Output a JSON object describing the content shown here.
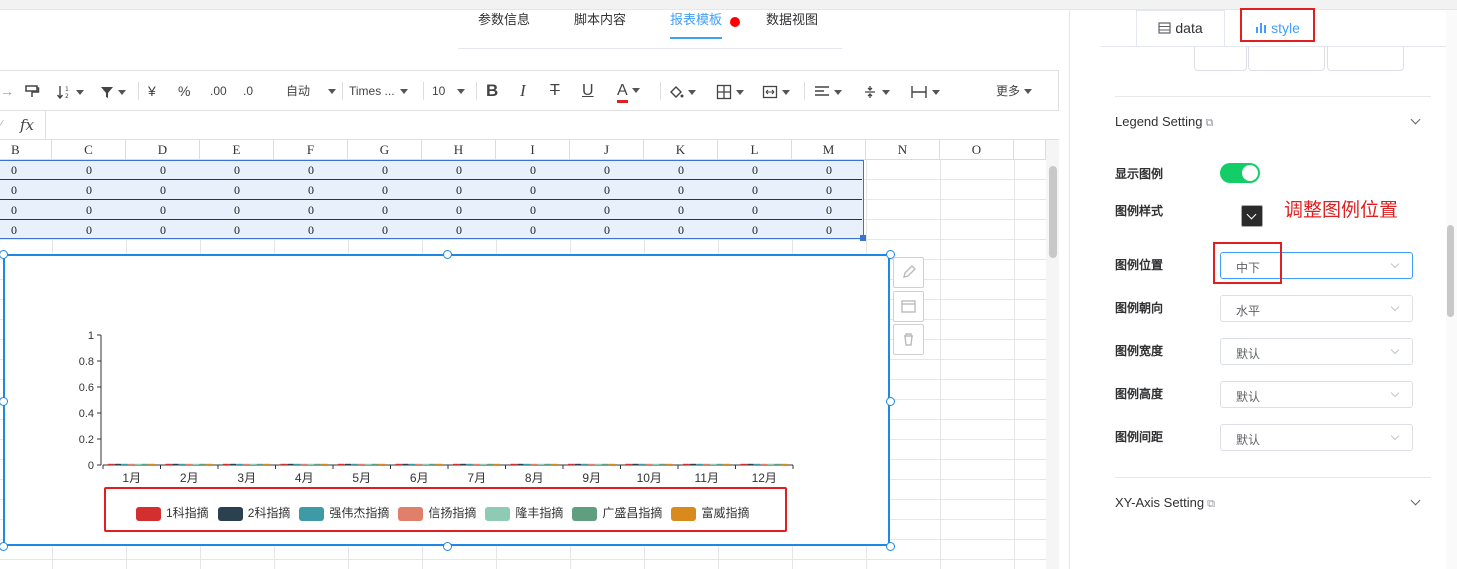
{
  "main_tabs": [
    {
      "label": "参数信息",
      "active": false
    },
    {
      "label": "脚本内容",
      "active": false
    },
    {
      "label": "报表模板",
      "active": true
    },
    {
      "label": "数据视图",
      "active": false
    }
  ],
  "toolbar": {
    "wrap_mode": "自动",
    "font_name": "Times ...",
    "font_size": "10",
    "bold": "B",
    "italic": "I",
    "strike": "T",
    "underline": "U",
    "font_color": "A",
    "more": "更多",
    "currency": "¥",
    "percent": "%",
    "decimal_inc": ".00",
    "decimal_dec": ".0",
    "font_color_hex": "#e02020"
  },
  "formula_bar": {
    "fx_label": "fx"
  },
  "columns": [
    "B",
    "C",
    "D",
    "E",
    "F",
    "G",
    "H",
    "I",
    "J",
    "K",
    "L",
    "M",
    "N",
    "O"
  ],
  "data_rows": [
    [
      "0",
      "0",
      "0",
      "0",
      "0",
      "0",
      "0",
      "0",
      "0",
      "0",
      "0",
      "0"
    ],
    [
      "0",
      "0",
      "0",
      "0",
      "0",
      "0",
      "0",
      "0",
      "0",
      "0",
      "0",
      "0"
    ],
    [
      "0",
      "0",
      "0",
      "0",
      "0",
      "0",
      "0",
      "0",
      "0",
      "0",
      "0",
      "0"
    ],
    [
      "0",
      "0",
      "0",
      "0",
      "0",
      "0",
      "0",
      "0",
      "0",
      "0",
      "0",
      "0"
    ]
  ],
  "chart_data": {
    "type": "bar",
    "categories": [
      "1月",
      "2月",
      "3月",
      "4月",
      "5月",
      "6月",
      "7月",
      "8月",
      "9月",
      "10月",
      "11月",
      "12月"
    ],
    "series": [
      {
        "name": "1科指摘",
        "color": "#d32f2f",
        "values": [
          0,
          0,
          0,
          0,
          0,
          0,
          0,
          0,
          0,
          0,
          0,
          0
        ]
      },
      {
        "name": "2科指摘",
        "color": "#2b4150",
        "values": [
          0,
          0,
          0,
          0,
          0,
          0,
          0,
          0,
          0,
          0,
          0,
          0
        ]
      },
      {
        "name": "强伟杰指摘",
        "color": "#3f9aa7",
        "values": [
          0,
          0,
          0,
          0,
          0,
          0,
          0,
          0,
          0,
          0,
          0,
          0
        ]
      },
      {
        "name": "信扬指摘",
        "color": "#e0806b",
        "values": [
          0,
          0,
          0,
          0,
          0,
          0,
          0,
          0,
          0,
          0,
          0,
          0
        ]
      },
      {
        "name": "隆丰指摘",
        "color": "#8dcbb4",
        "values": [
          0,
          0,
          0,
          0,
          0,
          0,
          0,
          0,
          0,
          0,
          0,
          0
        ]
      },
      {
        "name": "广盛昌指摘",
        "color": "#5f9e7e",
        "values": [
          0,
          0,
          0,
          0,
          0,
          0,
          0,
          0,
          0,
          0,
          0,
          0
        ]
      },
      {
        "name": "富威指摘",
        "color": "#d98a1c",
        "values": [
          0,
          0,
          0,
          0,
          0,
          0,
          0,
          0,
          0,
          0,
          0,
          0
        ]
      }
    ],
    "yticks": [
      "0",
      "0.2",
      "0.4",
      "0.6",
      "0.8",
      "1"
    ],
    "ylim": [
      0,
      1
    ],
    "legend": "bottom-center",
    "grid": false
  },
  "right_panel": {
    "tabs": [
      {
        "label": "data",
        "icon": "table-icon",
        "active": false
      },
      {
        "label": "style",
        "icon": "bar-chart-icon",
        "active": true
      }
    ],
    "legend_section_title": "Legend Setting",
    "xy_section_title": "XY-Axis Setting",
    "show_legend_label": "显示图例",
    "show_legend_on": true,
    "legend_style_label": "图例样式",
    "legend_position_label": "图例位置",
    "legend_position_value": "中下",
    "legend_orient_label": "图例朝向",
    "legend_orient_value": "水平",
    "legend_width_label": "图例宽度",
    "legend_width_value": "默认",
    "legend_height_label": "图例高度",
    "legend_height_value": "默认",
    "legend_gap_label": "图例间距",
    "legend_gap_value": "默认",
    "annotation": "调整图例位置",
    "annotation_color": "#e02020"
  }
}
